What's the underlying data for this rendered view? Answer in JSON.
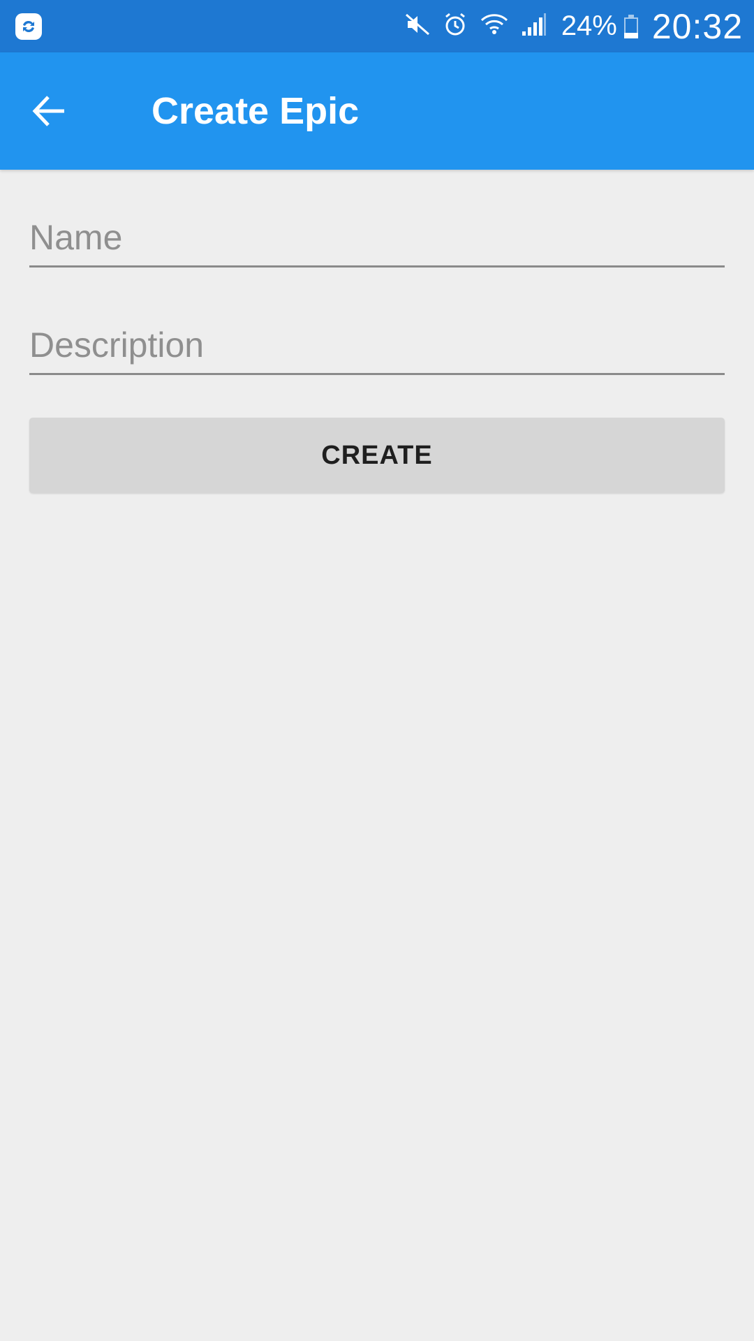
{
  "status_bar": {
    "app_icon": "sync-app-icon",
    "icons": [
      "mute-icon",
      "alarm-icon",
      "wifi-icon",
      "signal-icon"
    ],
    "battery_percent": "24%",
    "battery_level": 0.24,
    "time": "20:32"
  },
  "toolbar": {
    "back_icon": "arrow-back-icon",
    "title": "Create Epic"
  },
  "form": {
    "name_placeholder": "Name",
    "name_value": "",
    "description_placeholder": "Description",
    "description_value": "",
    "create_label": "CREATE"
  },
  "colors": {
    "status_bar": "#1e78d2",
    "app_bar": "#2194ef",
    "background": "#eeeeee",
    "button": "#d6d6d6"
  }
}
